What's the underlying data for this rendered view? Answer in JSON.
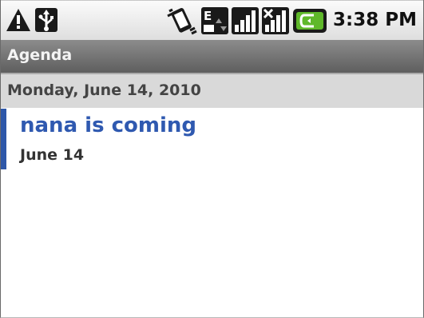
{
  "status_bar": {
    "time": "3:38 PM",
    "icons": [
      "warning-icon",
      "usb-icon",
      "vibrate-icon",
      "edge-data-icon",
      "signal-icon",
      "roaming-signal-icon",
      "battery-charging-icon"
    ]
  },
  "title_bar": {
    "title": "Agenda"
  },
  "agenda": {
    "day_header": "Monday, June 14, 2010",
    "events": [
      {
        "title": "nana is coming",
        "date": "June 14",
        "color": "#2e57a8"
      }
    ]
  },
  "colors": {
    "event_title": "#2f59b0",
    "title_bar": "#6e6e6e",
    "day_header_bg": "#d9d9d9",
    "battery": "#5fb82a"
  }
}
